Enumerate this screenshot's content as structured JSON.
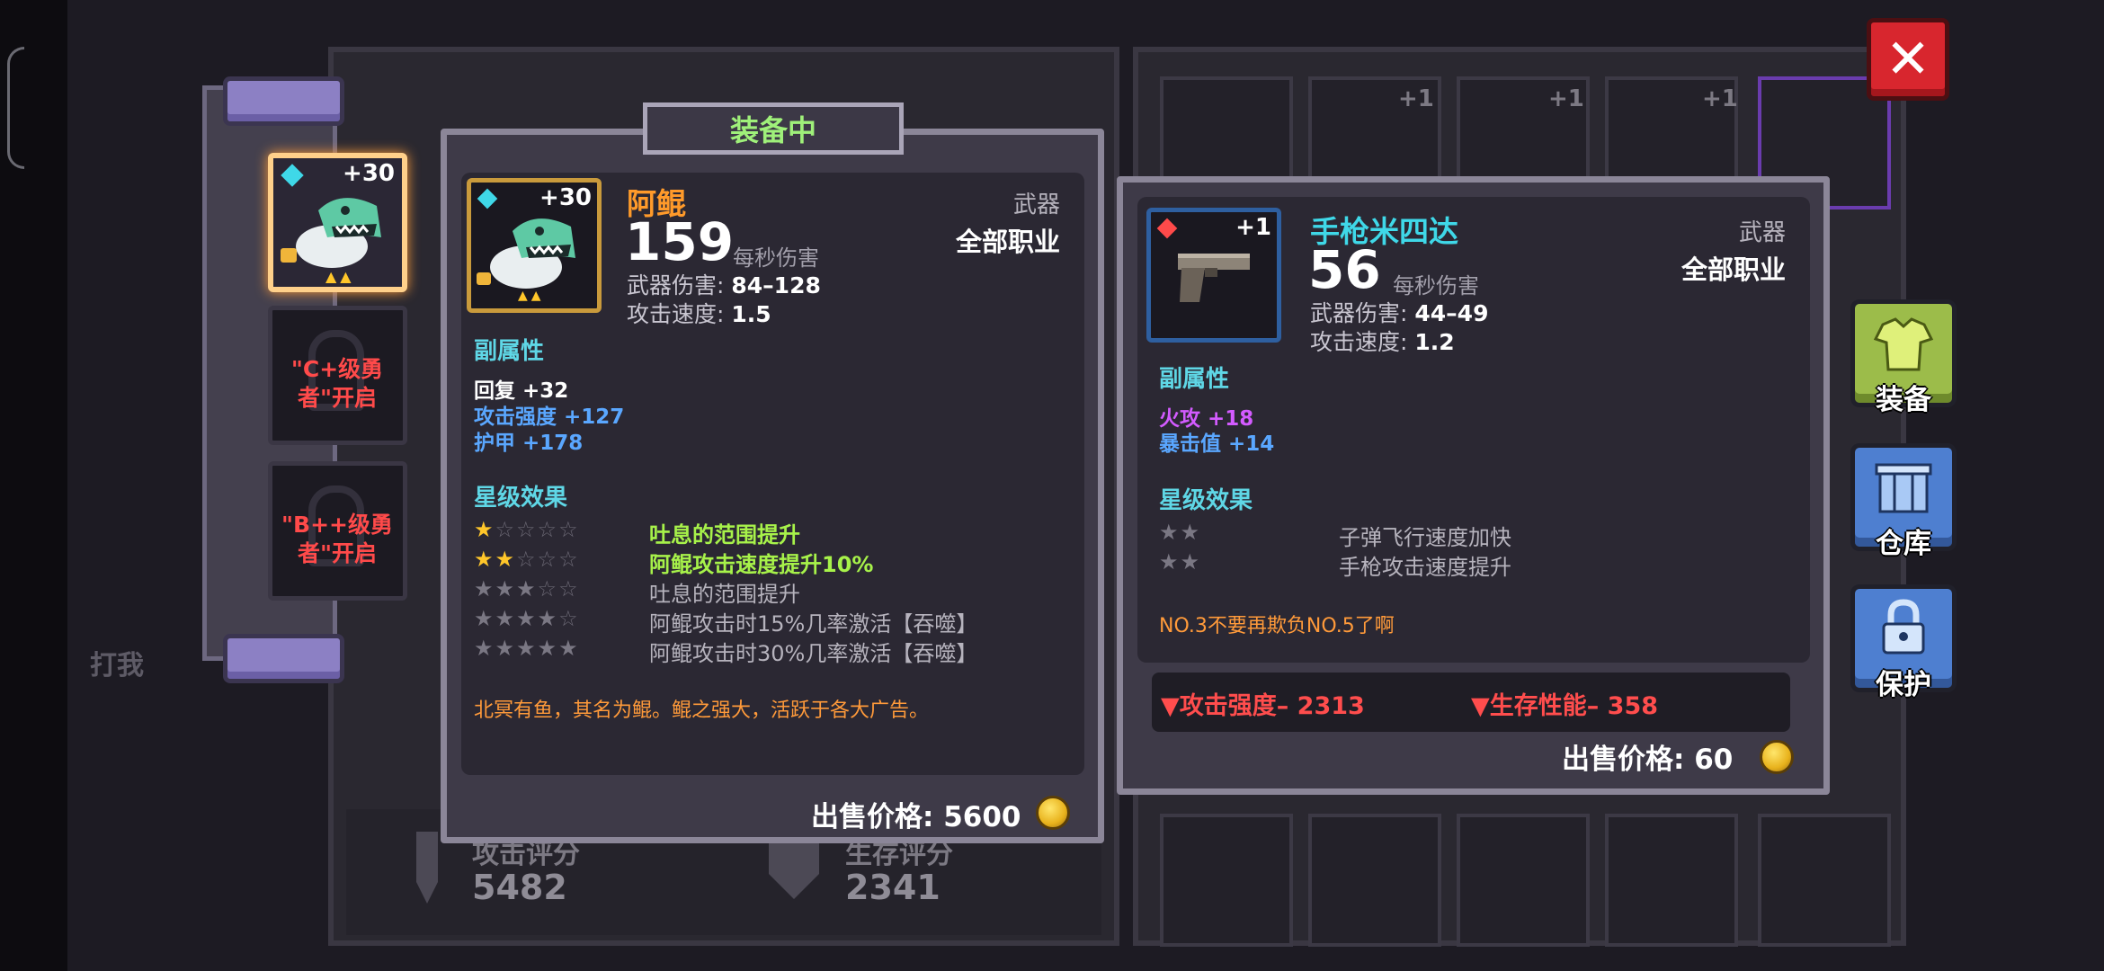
{
  "background": {
    "dim_label": "打我",
    "attack_label": "攻击评分",
    "attack_value": "5482",
    "survival_label": "生存评分",
    "survival_value": "2341",
    "inv_counts": [
      "+1",
      "+1",
      "+1"
    ]
  },
  "slots": {
    "selected_level": "+30",
    "locked_1": "\"C+级勇者\"开启",
    "locked_2": "\"B++级勇者\"开启"
  },
  "equipped": {
    "badge": "装备中",
    "icon": "green-dragon-fish-icon",
    "level": "+30",
    "name": "阿鲲",
    "name_color": "#ff9a2a",
    "dps": "159",
    "dps_label": "每秒伤害",
    "type": "武器",
    "job": "全部职业",
    "weapon_damage_label": "武器伤害:",
    "weapon_damage": "84–128",
    "attack_speed_label": "攻击速度:",
    "attack_speed": "1.5",
    "sub_title": "副属性",
    "subs": [
      {
        "text": "回复 +32",
        "color": "#ffffff"
      },
      {
        "text": "攻击强度 +127",
        "color": "#5aa7ff"
      },
      {
        "text": "护甲 +178",
        "color": "#5aa7ff"
      }
    ],
    "star_title": "星级效果",
    "star_effects": [
      {
        "stars": 1,
        "text": "吐息的范围提升",
        "active": true
      },
      {
        "stars": 2,
        "text": "阿鲲攻击速度提升10%",
        "active": true
      },
      {
        "stars": 3,
        "text": "吐息的范围提升",
        "active": false
      },
      {
        "stars": 4,
        "text": "阿鲲攻击时15%几率激活【吞噬】",
        "active": false
      },
      {
        "stars": 5,
        "text": "阿鲲攻击时30%几率激活【吞噬】",
        "active": false
      }
    ],
    "description": "北冥有鱼，其名为鲲。鲲之强大，活跃于各大广告。",
    "price_label": "出售价格: 5600"
  },
  "compare": {
    "icon": "pistol-icon",
    "level": "+1",
    "name": "手枪米四达",
    "name_color": "#3fd8e8",
    "dps": "56",
    "dps_label": "每秒伤害",
    "type": "武器",
    "job": "全部职业",
    "weapon_damage_label": "武器伤害:",
    "weapon_damage": "44–49",
    "attack_speed_label": "攻击速度:",
    "attack_speed": "1.2",
    "sub_title": "副属性",
    "subs": [
      {
        "text": "火攻 +18",
        "color": "#d35bff"
      },
      {
        "text": "暴击值 +14",
        "color": "#5aa7ff"
      }
    ],
    "star_title": "星级效果",
    "star_effects": [
      {
        "stars": 2,
        "text": "子弹飞行速度加快",
        "active": false
      },
      {
        "stars": 2,
        "text": "手枪攻击速度提升",
        "active": false
      }
    ],
    "description": "NO.3不要再欺负NO.5了啊",
    "diff_attack": "▼攻击强度– 2313",
    "diff_survival": "▼生存性能– 358",
    "price_label": "出售价格: 60"
  },
  "side_buttons": {
    "equip": "装备",
    "storage": "仓库",
    "protect": "保护"
  },
  "colors": {
    "accent_green": "#9ff07a",
    "star_gold": "#ffc62a",
    "star_gray": "#7a7783",
    "active_effect_green": "#a7f24a",
    "inactive_effect_gray": "#b6b3bd",
    "close_red": "#d8262e"
  }
}
